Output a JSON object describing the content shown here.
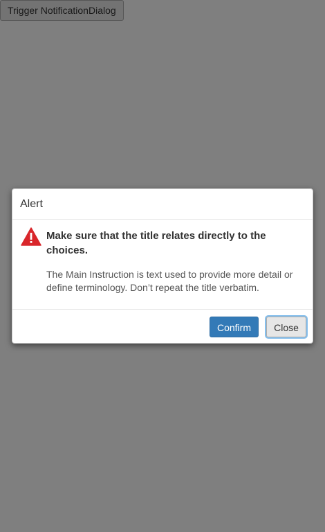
{
  "page": {
    "trigger_button_label": "Trigger NotificationDialog"
  },
  "dialog": {
    "title": "Alert",
    "icon": "warning-triangle-icon",
    "main_instruction": "Make sure that the title relates directly to the choices.",
    "content": "The Main Instruction is text used to provide more detail or define terminology. Don’t repeat the title verbatim.",
    "buttons": {
      "confirm_label": "Confirm",
      "close_label": "Close"
    }
  },
  "colors": {
    "overlay": "#808080",
    "primary": "#337ab7",
    "warning": "#d9262b"
  }
}
